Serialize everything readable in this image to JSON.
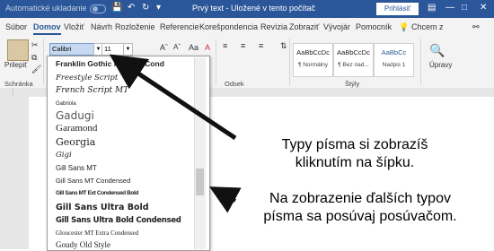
{
  "titlebar": {
    "autosave": "Automatické ukladanie",
    "doc_title": "Prvý text - Uložené v tento počítač",
    "signin": "Prihlásiť"
  },
  "tabs": [
    "Súbor",
    "Domov",
    "Vložiť",
    "Návrh",
    "Rozloženie",
    "Referencie",
    "Korešpondencia",
    "Revízia",
    "Zobraziť",
    "Vývojár",
    "Pomocník"
  ],
  "search_text": "Chcem z",
  "ribbon": {
    "paste_label": "Prilepiť",
    "clipboard_label": "Schránka",
    "font_value": "Calibri",
    "size_value": "11",
    "paragraph_label": "Odsek",
    "styles_label": "Štýly",
    "edit_label": "Úpravy",
    "styles": [
      {
        "sample": "AaBbCcDc",
        "name": "¶ Normálny"
      },
      {
        "sample": "AaBbCcDc",
        "name": "¶ Bez riad..."
      },
      {
        "sample": "AaBbCc",
        "name": "Nadpis 1"
      }
    ]
  },
  "font_list": [
    "Franklin Gothic Medium Cond",
    "Freestyle Script",
    "French Script MT",
    "Gabriola",
    "Gadugi",
    "Garamond",
    "Georgia",
    "Gigi",
    "Gill Sans MT",
    "Gill Sans MT Condensed",
    "Gill Sans MT Ext Condensed Bold",
    "Gill Sans Ultra Bold",
    "Gill Sans Ultra Bold Condensed",
    "Gloucester MT Extra Condensed",
    "Goudy Old Style"
  ],
  "callouts": {
    "arrow_text_1": "Typy písma si zobrazíš",
    "arrow_text_2": "kliknutím na šípku.",
    "scroll_text_1": "Na zobrazenie ďalších typov",
    "scroll_text_2": "písma sa posúvaj posúvačom."
  }
}
